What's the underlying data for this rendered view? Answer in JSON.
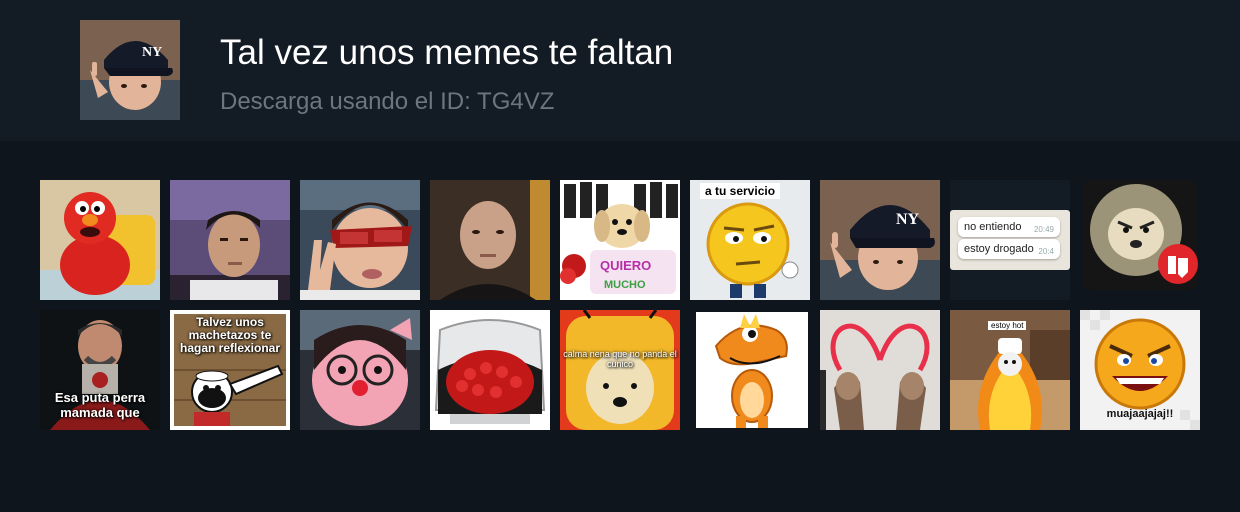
{
  "header": {
    "title": "Tal vez unos memes te faltan",
    "subtitle": "Descarga usando el ID: TG4VZ",
    "avatar_icon": "pack-avatar-boy-ny-cap"
  },
  "colors": {
    "page_bg": "#0e151c",
    "header_bg": "#131b24",
    "title": "#ffffff",
    "subtitle": "#6c7680"
  },
  "stickers": [
    {
      "icon": "elmo-potty-sticker"
    },
    {
      "icon": "young-man-selfie-sticker"
    },
    {
      "icon": "kid-sunglasses-peace-sticker"
    },
    {
      "icon": "bald-man-sticker"
    },
    {
      "icon": "puppy-band-te-quiero-sticker"
    },
    {
      "icon": "emoji-a-tu-servicio-sticker",
      "caption": "a tu servicio"
    },
    {
      "icon": "boy-ny-cap-sticker"
    },
    {
      "icon": "chat-bubbles-sticker",
      "line1": "no entiendo",
      "time1": "20:49",
      "line2": "estoy drogado",
      "time2": "20:4"
    },
    {
      "icon": "angry-dog-dislike-sticker"
    },
    {
      "icon": "omni-man-sticker",
      "caption": "Esa puta perra mamada que"
    },
    {
      "icon": "cuphead-pointing-sticker",
      "caption": "Talvez unos machetazos te hagan reflexionar"
    },
    {
      "icon": "pink-cartoon-glasses-sticker"
    },
    {
      "icon": "car-trunk-roses-sticker"
    },
    {
      "icon": "dog-costume-calma-nena-sticker",
      "caption": "calma nena que no panda el cunico"
    },
    {
      "icon": "orange-dinosaur-sticker"
    },
    {
      "icon": "feet-heart-sticker"
    },
    {
      "icon": "chef-fire-estoy-hot-sticker",
      "caption": "estoy hot"
    },
    {
      "icon": "evil-laugh-emoji-sticker",
      "caption": "muajaajajaj!!"
    }
  ]
}
